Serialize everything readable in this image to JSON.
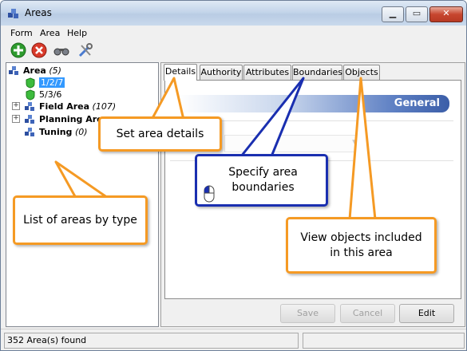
{
  "window": {
    "title": "Areas"
  },
  "menu": {
    "items": [
      "Form",
      "Area",
      "Help"
    ]
  },
  "toolbar": {
    "buttons": [
      "add-icon",
      "delete-icon",
      "search-binoculars-icon",
      "tools-icon"
    ]
  },
  "tree": {
    "root": {
      "label": "Area",
      "count": "(5)"
    },
    "children": [
      {
        "label": "1/2/7",
        "selected": true
      },
      {
        "label": "5/3/6"
      }
    ],
    "groups": [
      {
        "label": "Field Area",
        "count": "(107)"
      },
      {
        "label": "Planning Area",
        "count": ""
      },
      {
        "label": "Tuning",
        "count": "(0)"
      }
    ]
  },
  "tabs": [
    "Details",
    "Authority",
    "Attributes",
    "Boundaries",
    "Objects"
  ],
  "active_tab": "Details",
  "details": {
    "section_title": "General"
  },
  "buttons": {
    "save": "Save",
    "cancel": "Cancel",
    "edit": "Edit"
  },
  "status": {
    "text": "352 Area(s) found"
  },
  "callouts": {
    "set_details": "Set area details",
    "specify_boundaries": "Specify area boundaries",
    "view_objects": "View objects included in this area",
    "list_areas": "List of areas by type"
  },
  "colors": {
    "callout_orange": "#f59a24",
    "callout_blue": "#1a2fb0",
    "selection": "#3399ff",
    "header_blue": "#3b5ea8"
  }
}
